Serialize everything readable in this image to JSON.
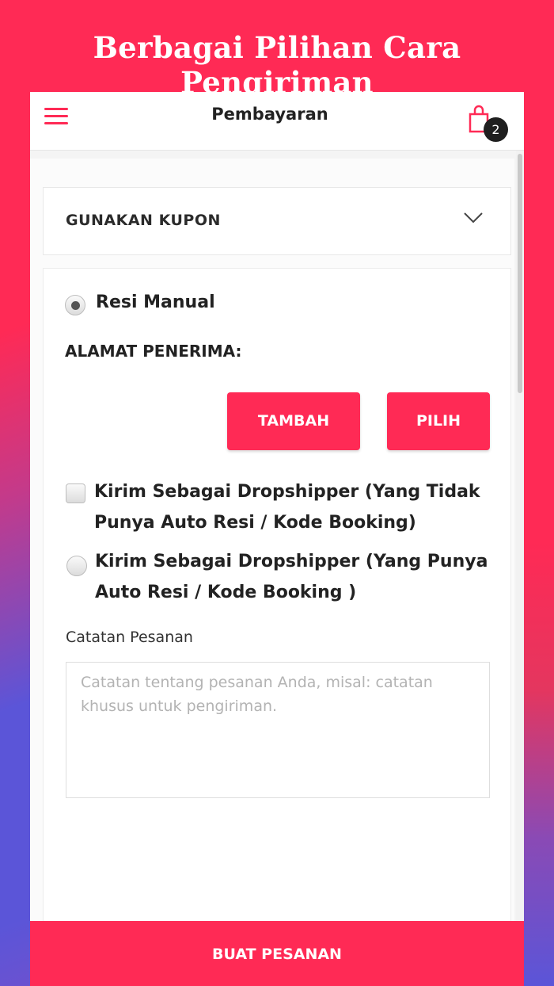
{
  "promo": {
    "title": "Berbagai Pilihan Cara Pengiriman"
  },
  "appbar": {
    "title": "Pembayaran",
    "cart_count": "2"
  },
  "coupon": {
    "label": "GUNAKAN KUPON"
  },
  "shipping": {
    "resi_manual_label": "Resi Manual",
    "address_heading": "ALAMAT PENERIMA:",
    "add_button": "TAMBAH",
    "choose_button": "PILIH",
    "dropship_no_resi": {
      "line1": "Kirim Sebagai Dropshipper (Yang Tidak",
      "line2": "Punya Auto Resi / Kode Booking)"
    },
    "dropship_with_resi": {
      "line1": "Kirim Sebagai Dropshipper (Yang Punya",
      "line2": "Auto Resi / Kode Booking )"
    }
  },
  "notes": {
    "label": "Catatan Pesanan",
    "placeholder": "Catatan tentang pesanan Anda, misal: catatan khusus untuk pengiriman.",
    "value": ""
  },
  "footer": {
    "submit_label": "BUAT PESANAN"
  },
  "colors": {
    "accent": "#ff2a55",
    "secondary": "#5b55d8"
  }
}
